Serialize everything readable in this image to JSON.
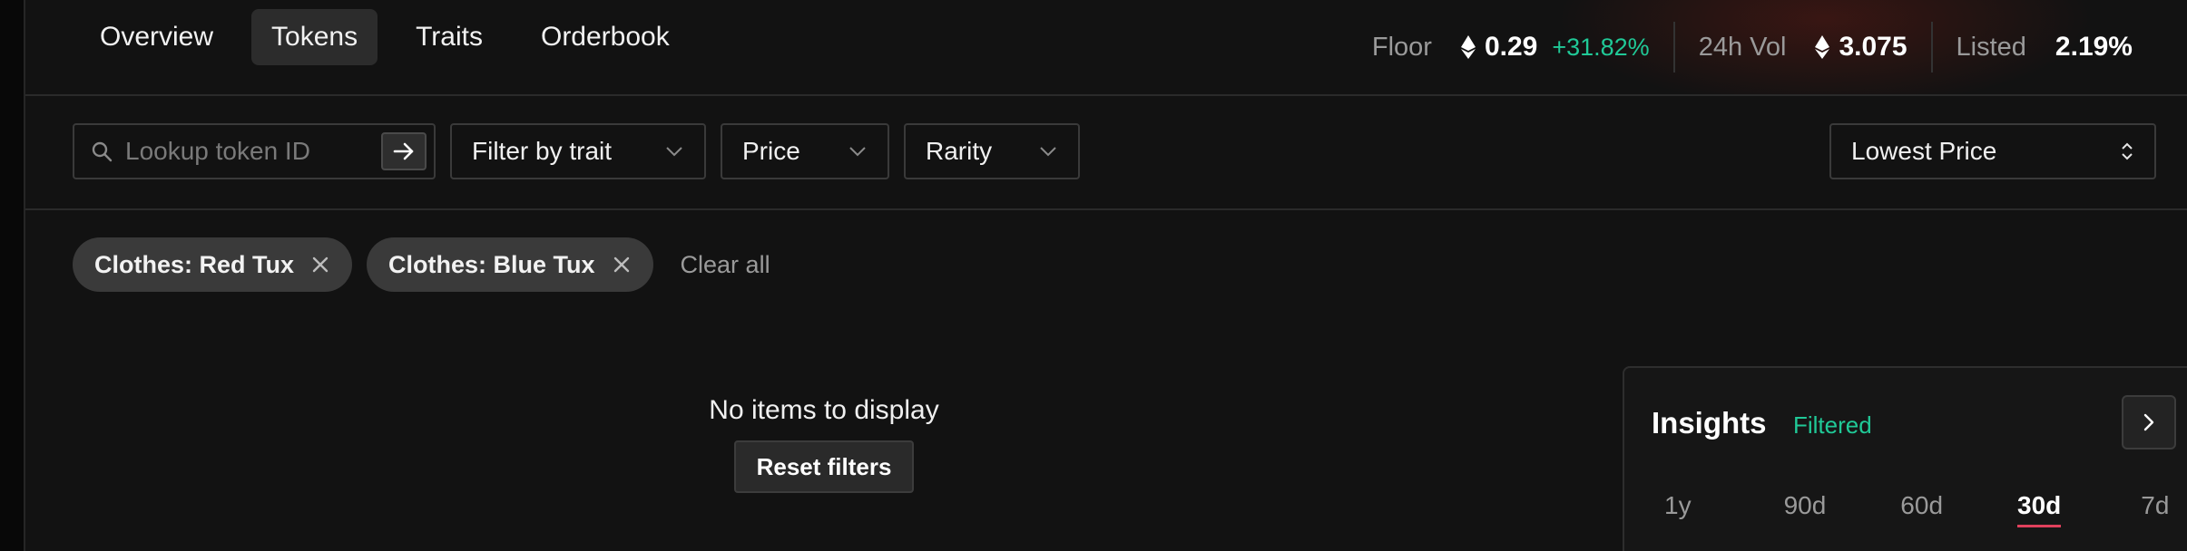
{
  "nav": {
    "tabs": [
      {
        "label": "Overview",
        "active": false
      },
      {
        "label": "Tokens",
        "active": true
      },
      {
        "label": "Traits",
        "active": false
      },
      {
        "label": "Orderbook",
        "active": false
      }
    ]
  },
  "stats": {
    "floor": {
      "label": "Floor",
      "value": "0.29",
      "change": "+31.82%"
    },
    "volume": {
      "label": "24h Vol",
      "value": "3.075"
    },
    "listed": {
      "label": "Listed",
      "value": "2.19%"
    }
  },
  "filters": {
    "search_placeholder": "Lookup token ID",
    "trait_label": "Filter by trait",
    "price_label": "Price",
    "rarity_label": "Rarity",
    "sort_label": "Lowest Price"
  },
  "chips": [
    {
      "label": "Clothes: Red Tux"
    },
    {
      "label": "Clothes: Blue Tux"
    }
  ],
  "clear_all_label": "Clear all",
  "empty_state": {
    "message": "No items to display",
    "reset_label": "Reset filters"
  },
  "insights": {
    "title": "Insights",
    "badge": "Filtered",
    "ranges": [
      {
        "label": "1y",
        "active": false
      },
      {
        "label": "90d",
        "active": false
      },
      {
        "label": "60d",
        "active": false
      },
      {
        "label": "30d",
        "active": true
      },
      {
        "label": "7d",
        "active": false
      }
    ]
  },
  "colors": {
    "background": "#121212",
    "positive": "#20c997",
    "active_underline": "#e0405c"
  }
}
